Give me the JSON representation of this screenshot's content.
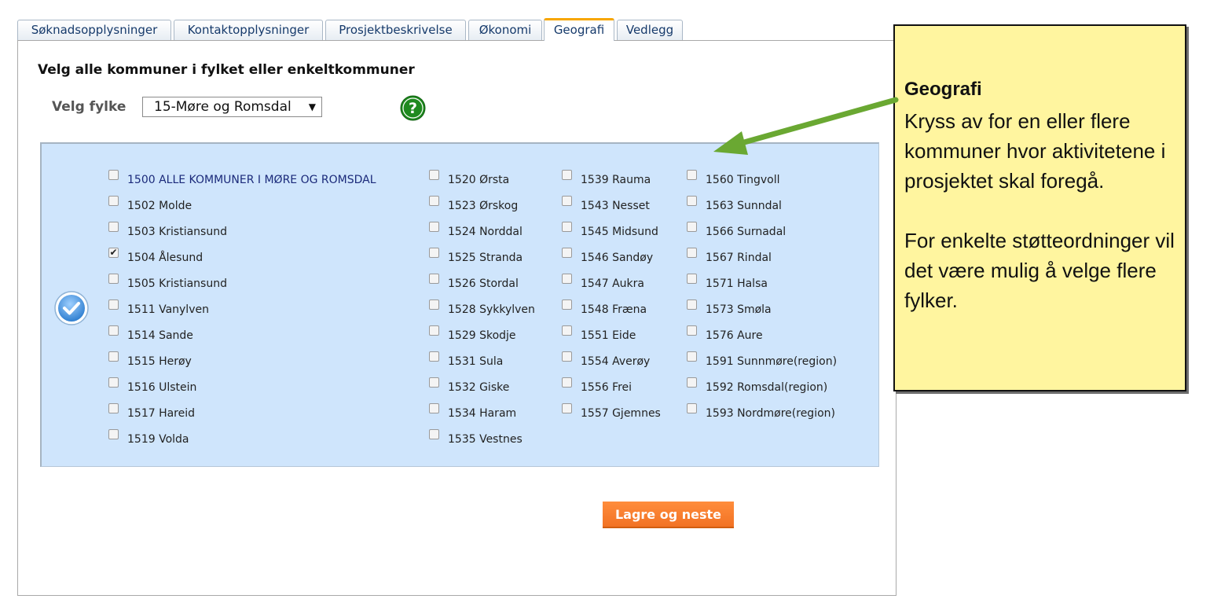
{
  "tabs": [
    {
      "label": "Søknadsopplysninger",
      "active": false
    },
    {
      "label": "Kontaktopplysninger",
      "active": false
    },
    {
      "label": "Prosjektbeskrivelse",
      "active": false
    },
    {
      "label": "Økonomi",
      "active": false
    },
    {
      "label": "Geografi",
      "active": true
    },
    {
      "label": "Vedlegg",
      "active": false
    }
  ],
  "main": {
    "heading": "Velg alle kommuner i fylket eller enkeltkommuner",
    "fylke_label": "Velg fylke",
    "fylke_selected": "15-Møre og Romsdal",
    "save_label": "Lagre og neste"
  },
  "municipalities": {
    "col1": [
      {
        "label": "1500 ALLE KOMMUNER I MØRE OG ROMSDAL",
        "checked": false
      },
      {
        "label": "1502 Molde",
        "checked": false
      },
      {
        "label": "1503 Kristiansund",
        "checked": false
      },
      {
        "label": "1504 Ålesund",
        "checked": true
      },
      {
        "label": "1505 Kristiansund",
        "checked": false
      },
      {
        "label": "1511 Vanylven",
        "checked": false
      },
      {
        "label": "1514 Sande",
        "checked": false
      },
      {
        "label": "1515 Herøy",
        "checked": false
      },
      {
        "label": "1516 Ulstein",
        "checked": false
      },
      {
        "label": "1517 Hareid",
        "checked": false
      },
      {
        "label": "1519 Volda",
        "checked": false
      }
    ],
    "col2": [
      {
        "label": "1520 Ørsta",
        "checked": false
      },
      {
        "label": "1523 Ørskog",
        "checked": false
      },
      {
        "label": "1524 Norddal",
        "checked": false
      },
      {
        "label": "1525 Stranda",
        "checked": false
      },
      {
        "label": "1526 Stordal",
        "checked": false
      },
      {
        "label": "1528 Sykkylven",
        "checked": false
      },
      {
        "label": "1529 Skodje",
        "checked": false
      },
      {
        "label": "1531 Sula",
        "checked": false
      },
      {
        "label": "1532 Giske",
        "checked": false
      },
      {
        "label": "1534 Haram",
        "checked": false
      },
      {
        "label": "1535 Vestnes",
        "checked": false
      }
    ],
    "col3": [
      {
        "label": "1539 Rauma",
        "checked": false
      },
      {
        "label": "1543 Nesset",
        "checked": false
      },
      {
        "label": "1545 Midsund",
        "checked": false
      },
      {
        "label": "1546 Sandøy",
        "checked": false
      },
      {
        "label": "1547 Aukra",
        "checked": false
      },
      {
        "label": "1548 Fræna",
        "checked": false
      },
      {
        "label": "1551 Eide",
        "checked": false
      },
      {
        "label": "1554 Averøy",
        "checked": false
      },
      {
        "label": "1556 Frei",
        "checked": false
      },
      {
        "label": "1557 Gjemnes",
        "checked": false
      }
    ],
    "col4": [
      {
        "label": "1560 Tingvoll",
        "checked": false
      },
      {
        "label": "1563 Sunndal",
        "checked": false
      },
      {
        "label": "1566 Surnadal",
        "checked": false
      },
      {
        "label": "1567 Rindal",
        "checked": false
      },
      {
        "label": "1571 Halsa",
        "checked": false
      },
      {
        "label": "1573 Smøla",
        "checked": false
      },
      {
        "label": "1576 Aure",
        "checked": false
      },
      {
        "label": "1591 Sunnmøre(region)",
        "checked": false
      },
      {
        "label": "1592 Romsdal(region)",
        "checked": false
      },
      {
        "label": "1593 Nordmøre(region)",
        "checked": false
      }
    ]
  },
  "callout": {
    "title": "Geografi",
    "paragraph1": "Kryss av for en eller flere kommuner hvor aktivitetene i prosjektet skal foregå.",
    "paragraph2": "For enkelte støtteordninger vil det være mulig å velge flere fylker."
  },
  "icons": {
    "help": "help-question-icon",
    "check_all": "check-all-icon",
    "dropdown": "chevron-down-icon",
    "arrow": "annotation-arrow-icon"
  },
  "colors": {
    "tab_active_accent": "#f7a600",
    "muni_box_bg": "#cfe5fc",
    "save_button": "#f47a2c",
    "callout_bg": "#fff59f",
    "arrow": "#6aa832",
    "help_icon": "#1f8a1f",
    "check_all_icon": "#3d8fd8"
  }
}
